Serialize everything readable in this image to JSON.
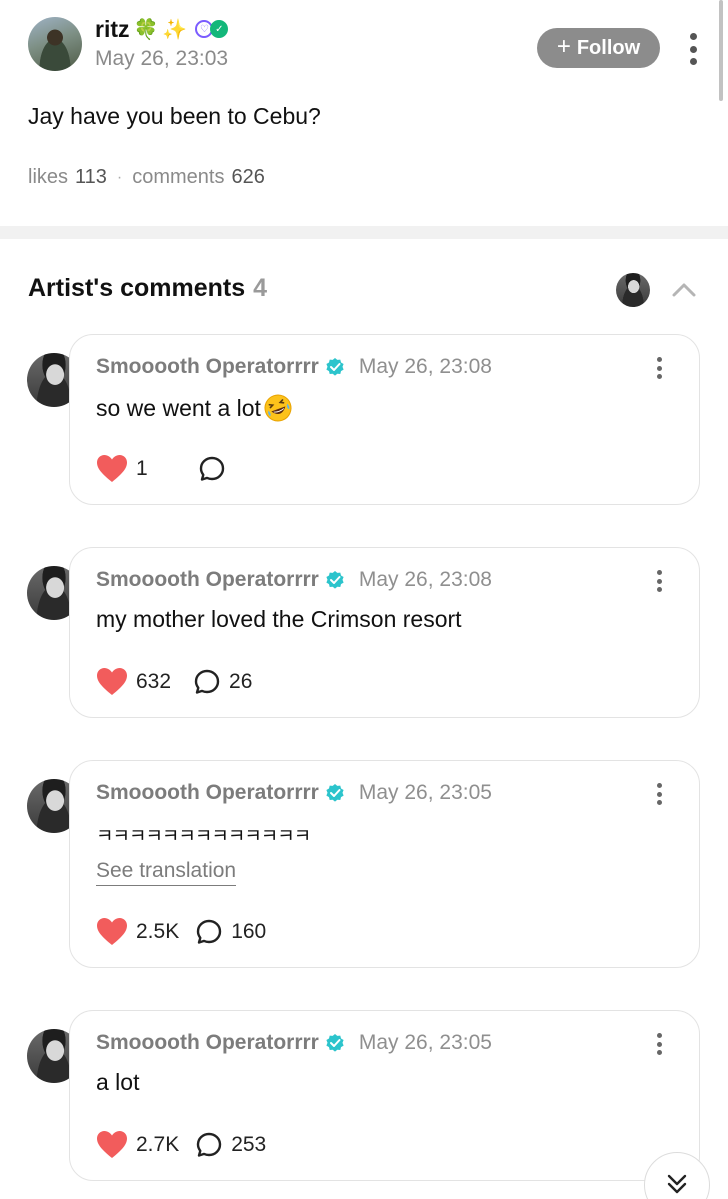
{
  "post": {
    "author": "ritz",
    "name_emojis": [
      "🍀",
      "✨"
    ],
    "date": "May 26, 23:03",
    "follow_label": "Follow",
    "text": "Jay have you been to Cebu?",
    "likes_label": "likes",
    "likes_count": "113",
    "comments_label": "comments",
    "comments_count": "626"
  },
  "artist_comments": {
    "title": "Artist's comments",
    "count": "4",
    "items": [
      {
        "author": "Smooooth Operatorrrr",
        "date": "May 26, 23:08",
        "text": "so we went a lot",
        "has_emoji": true,
        "likes": "1",
        "replies": ""
      },
      {
        "author": "Smooooth Operatorrrr",
        "date": "May 26, 23:08",
        "text": "my mother loved the Crimson resort",
        "likes": "632",
        "replies": "26"
      },
      {
        "author": "Smooooth Operatorrrr",
        "date": "May 26, 23:05",
        "text": "ㅋㅋㅋㅋㅋㅋㅋㅋㅋㅋㅋㅋㅋ",
        "translation_label": "See translation",
        "likes": "2.5K",
        "replies": "160"
      },
      {
        "author": "Smooooth Operatorrrr",
        "date": "May 26, 23:05",
        "text": "a lot",
        "likes": "2.7K",
        "replies": "253"
      }
    ]
  },
  "colors": {
    "heart": "#f25c5c",
    "verified": "#2cc4cc",
    "follow_bg": "#8c8c8c",
    "muted_text": "#8a8a8a"
  },
  "icons": [
    "more-vertical-icon",
    "chevron-up-icon",
    "verified-icon",
    "heart-icon",
    "comment-bubble-icon",
    "laughing-emoji-icon",
    "double-chevron-down-icon"
  ]
}
